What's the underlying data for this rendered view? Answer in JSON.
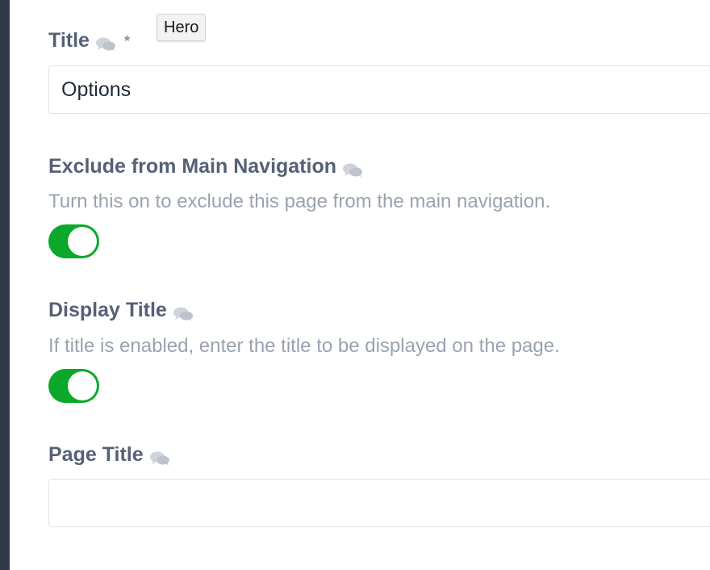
{
  "fields": {
    "title": {
      "label": "Title",
      "required_mark": "*",
      "value": "Options",
      "instructions_icon": "chat-bubbles-icon"
    },
    "exclude_nav": {
      "label": "Exclude from Main Navigation",
      "instructions": "Turn this on to exclude this page from the main navigation.",
      "enabled": true,
      "instructions_icon": "chat-bubbles-icon"
    },
    "display_title": {
      "label": "Display Title",
      "instructions": "If title is enabled, enter the title to be displayed on the page.",
      "enabled": true,
      "instructions_icon": "chat-bubbles-icon"
    },
    "page_title": {
      "label": "Page Title",
      "value": "",
      "instructions_icon": "chat-bubbles-icon"
    }
  },
  "tooltip": {
    "text": "Hero"
  },
  "colors": {
    "sidebar": "#323a4a",
    "label": "#566076",
    "instructions": "#9aa2b1",
    "toggle_on": "#0ba82c",
    "input_border": "#dfe2e7"
  }
}
